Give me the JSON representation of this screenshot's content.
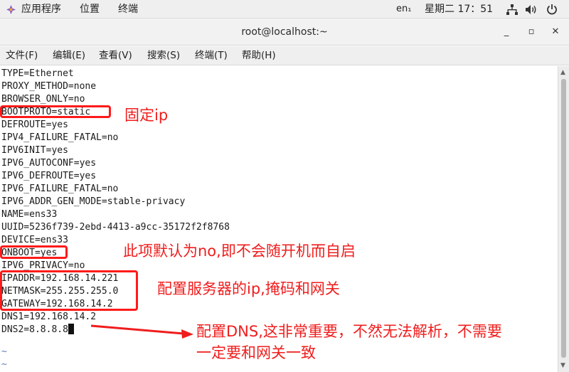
{
  "top_panel": {
    "applications": "应用程序",
    "places": "位置",
    "terminal": "终端",
    "input_method": "en₁",
    "clock": "星期二 17：51",
    "icons": [
      "network-icon",
      "volume-icon",
      "power-icon"
    ]
  },
  "window": {
    "title": "root@localhost:~",
    "minimize": "_",
    "maximize": "▫",
    "close": "✕"
  },
  "menubar": {
    "file": "文件(F)",
    "edit": "编辑(E)",
    "view": "查看(V)",
    "search": "搜索(S)",
    "terminal": "终端(T)",
    "help": "帮助(H)"
  },
  "terminal": {
    "lines": [
      "TYPE=Ethernet",
      "PROXY_METHOD=none",
      "BROWSER_ONLY=no",
      "BOOTPROTO=static",
      "DEFROUTE=yes",
      "IPV4_FAILURE_FATAL=no",
      "IPV6INIT=yes",
      "IPV6_AUTOCONF=yes",
      "IPV6_DEFROUTE=yes",
      "IPV6_FAILURE_FATAL=no",
      "IPV6_ADDR_GEN_MODE=stable-privacy",
      "NAME=ens33",
      "UUID=5236f739-2ebd-4413-a9cc-35172f2f8768",
      "DEVICE=ens33",
      "ONBOOT=yes",
      "IPV6_PRIVACY=no",
      "IPADDR=192.168.14.221",
      "NETMASK=255.255.255.0",
      "GATEWAY=192.168.14.2",
      "DNS1=192.168.14.2",
      "DNS2=8.8.8.8",
      "",
      "~",
      "~"
    ]
  },
  "annotations": {
    "bootproto": "固定ip",
    "onboot": "此项默认为no,即不会随开机而自启",
    "ipconfig": "配置服务器的ip,掩码和网关",
    "dns_line1": "配置DNS,这非常重要，不然无法解析，不需要",
    "dns_line2": "一定要和网关一致",
    "color": "#f01d1d"
  }
}
